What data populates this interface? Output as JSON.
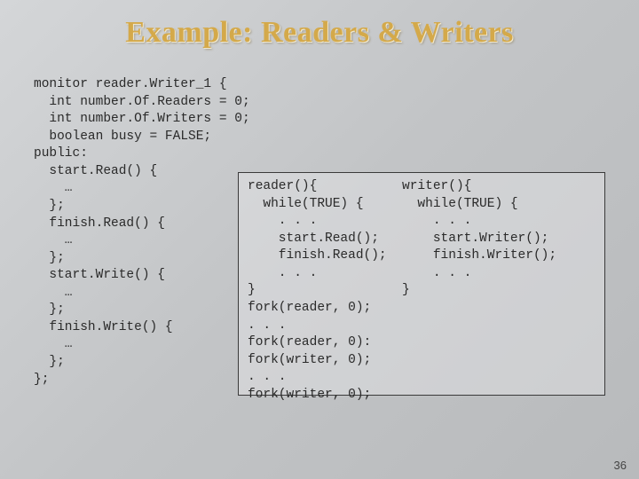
{
  "title": "Example: Readers & Writers",
  "code_left": "monitor reader.Writer_1 {\n  int number.Of.Readers = 0;\n  int number.Of.Writers = 0;\n  boolean busy = FALSE;\npublic:\n  start.Read() {\n    …\n  };\n  finish.Read() {\n    …\n  };\n  start.Write() {\n    …\n  };\n  finish.Write() {\n    …\n  };\n};",
  "code_box": "reader(){           writer(){\n  while(TRUE) {       while(TRUE) {\n    . . .               . . .\n    start.Read();       start.Writer();\n    finish.Read();      finish.Writer();\n    . . .               . . .\n}                   }\nfork(reader, 0);\n. . .\nfork(reader, 0):\nfork(writer, 0);\n. . .\nfork(writer, 0);",
  "page_number": "36"
}
